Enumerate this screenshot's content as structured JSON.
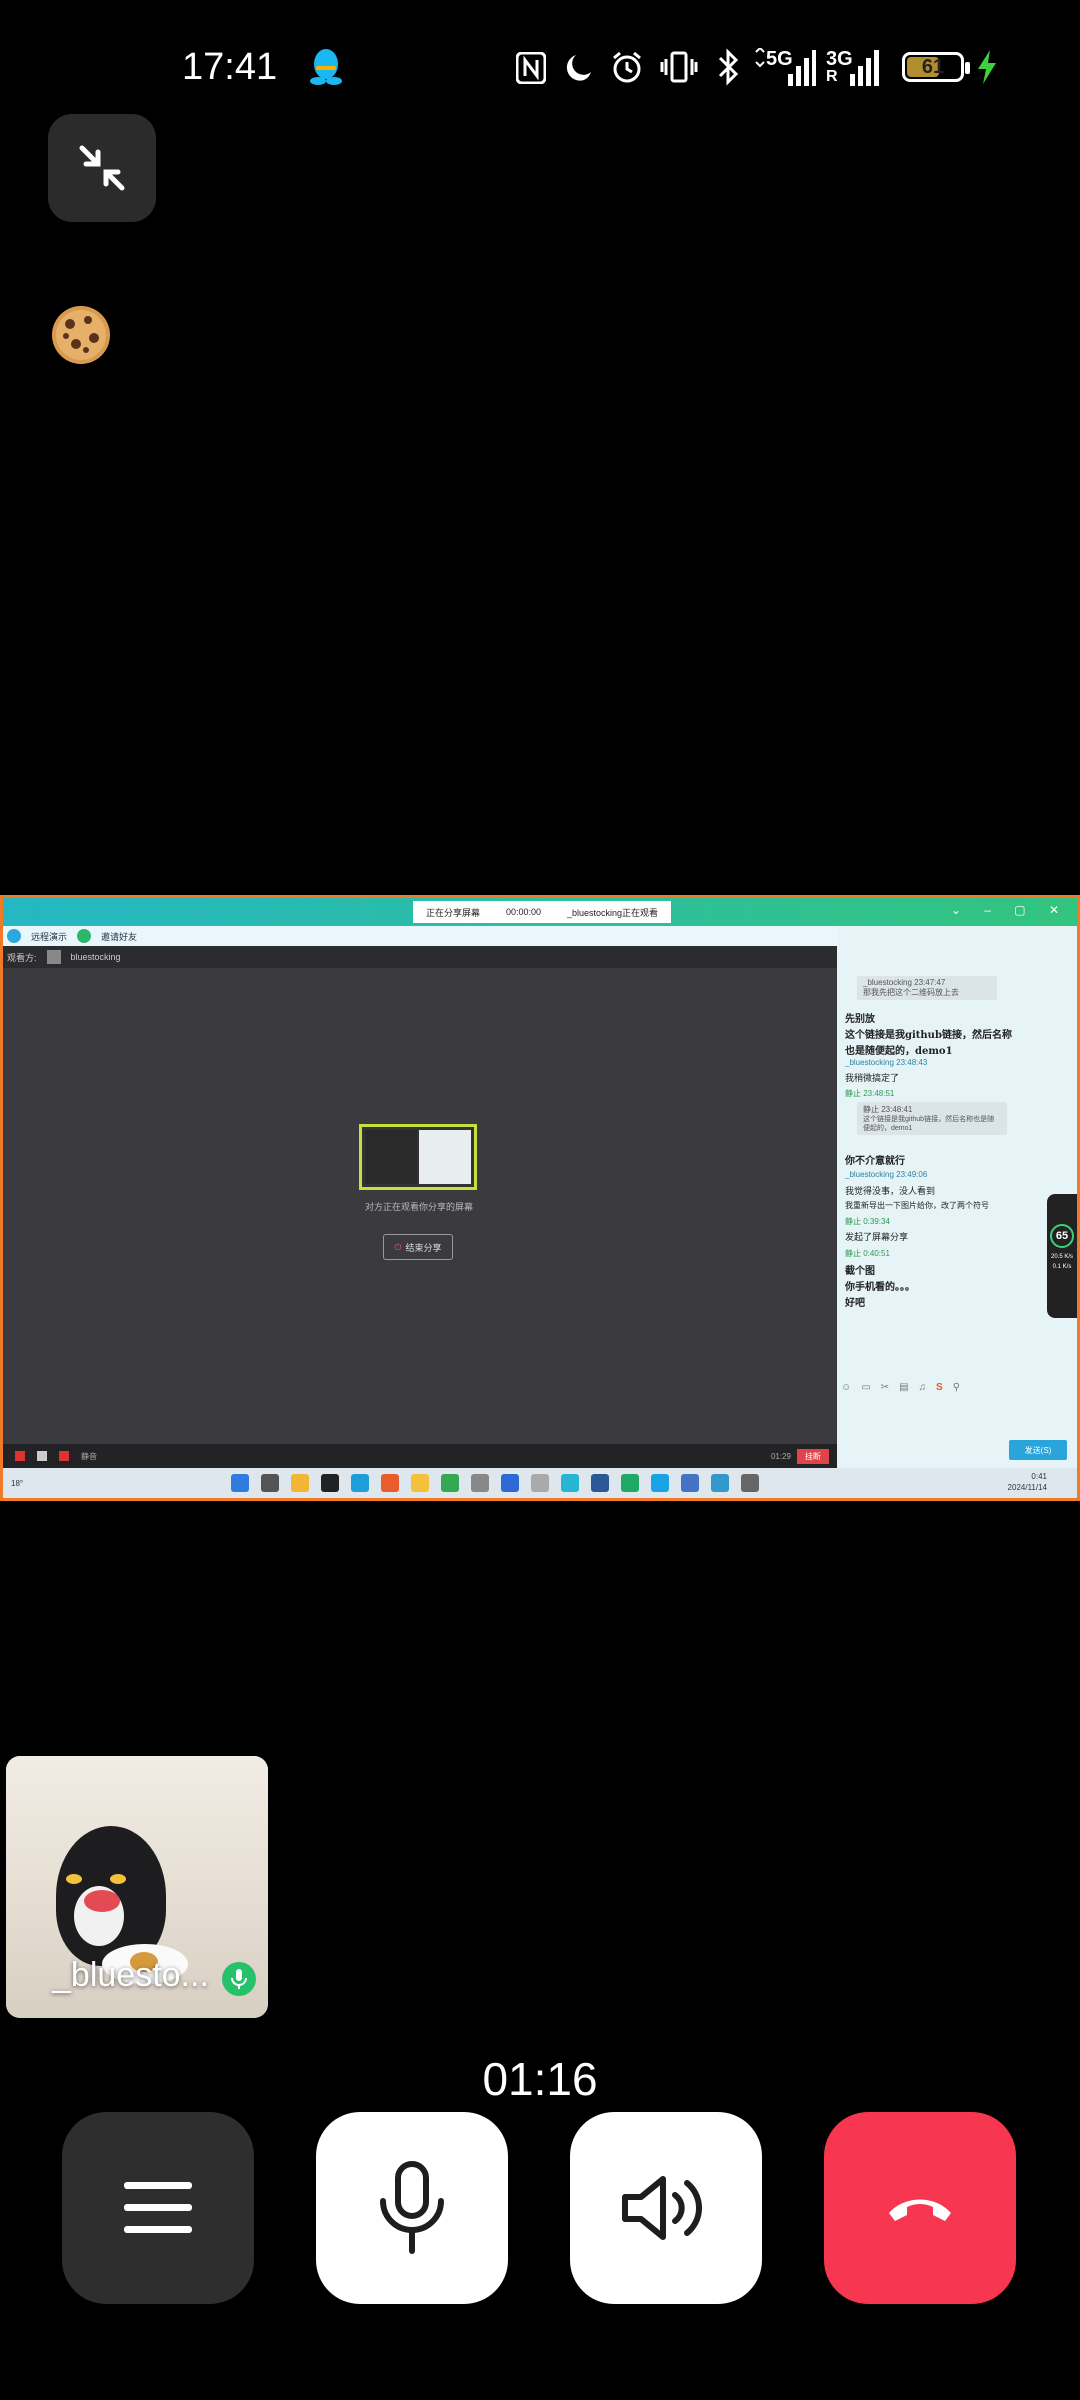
{
  "status_bar": {
    "time": "17:41",
    "battery_level": "61",
    "battery_fraction": 0.61,
    "net_5g": "5G",
    "net_3g": "3G",
    "roaming": "R",
    "icons": [
      "nfc-icon",
      "moon-icon",
      "alarm-icon",
      "vibrate-icon",
      "bluetooth-icon",
      "signal-icon",
      "signal-icon",
      "battery-icon",
      "charging-icon"
    ]
  },
  "colors": {
    "accent_green": "#25c26b",
    "hangup_red": "#f7364f",
    "share_border": "#f07a28"
  },
  "shared_screen": {
    "banner_status": "正在分享屏幕",
    "banner_time": "00:00:00",
    "banner_viewer": "_bluestocking正在观看",
    "toolbar_remote": "远程演示",
    "toolbar_invite": "邀请好友",
    "viewers_label": "观看方:",
    "viewer_name": "bluestocking",
    "sharing_text": "对方正在观看你分享的屏幕",
    "stop_label": "结束分享",
    "bottom_signal": "01:29",
    "bottom_hangup": "挂断",
    "bottom_label": "静音",
    "chat": {
      "m1_meta": "_bluestocking 23:47:47",
      "m1_quote": "那我先把这个二维码放上去",
      "m2": "先别放",
      "m3": "这个链接是我github链接，然后名称",
      "m4": "也是随便起的，demo1",
      "m5_meta": "_bluestocking 23:48:43",
      "m5": "我稍微搞定了",
      "m6_meta": "静止 23:48:51",
      "m6_quote1": "静止  23:48:41",
      "m6_quote2": "这个链接是我github链接，然后名称也是随便起的，demo1",
      "m7": "你不介意就行",
      "m8_meta": "_bluestocking 23:49:06",
      "m8": "我觉得没事，没人看到",
      "m9": "我重新导出一下图片给你，改了两个符号",
      "m10_meta": "静止 0:39:34",
      "m10": "发起了屏幕分享",
      "m11_meta": "静止 0:40:51",
      "m11": "截个图",
      "m12": "你手机看的。。。",
      "m13": "好吧",
      "send_label": "发送(S)",
      "speed": "65",
      "speed_up": "20.5 K/s",
      "speed_down": "0.1 K/s"
    },
    "taskbar_weather": "18°",
    "taskbar_time": "0:41",
    "taskbar_date": "2024/11/14"
  },
  "self_tile": {
    "name": "_bluesto..."
  },
  "call": {
    "timer": "01:16"
  }
}
